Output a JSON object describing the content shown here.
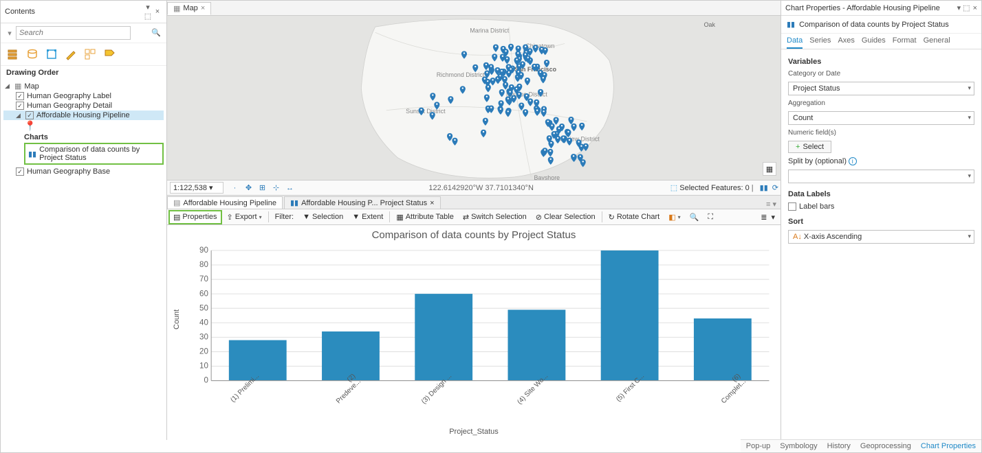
{
  "contents": {
    "title": "Contents",
    "search_placeholder": "Search",
    "drawing_order": "Drawing Order",
    "map_label": "Map",
    "layers": {
      "hgl": "Human Geography Label",
      "hgd": "Human Geography Detail",
      "ahp": "Affordable Housing Pipeline",
      "hgb": "Human Geography Base"
    },
    "charts_head": "Charts",
    "chart_item": "Comparison of data counts by Project Status"
  },
  "map": {
    "tab": "Map",
    "scale": "1:122,538",
    "coords": "122.6142920°W 37.7101340°N",
    "selected": "Selected Features: 0",
    "places": {
      "marina": "Marina District",
      "chinatown": "Chinatown",
      "richmond": "Richmond District",
      "sf": "San Francisco",
      "sunset": "Sunset District",
      "mission": "Mission District",
      "bayview": "Bayview District",
      "bayshore": "Bayshore",
      "oak": "Oak"
    }
  },
  "bottom": {
    "tab1": "Affordable Housing Pipeline",
    "tab2": "Affordable Housing P... Project Status",
    "toolbar": {
      "properties": "Properties",
      "export": "Export",
      "filter": "Filter:",
      "selection": "Selection",
      "extent": "Extent",
      "attr_table": "Attribute Table",
      "switch_sel": "Switch Selection",
      "clear_sel": "Clear Selection",
      "rotate": "Rotate Chart"
    }
  },
  "chart_data": {
    "type": "bar",
    "title": "Comparison of data counts by Project Status",
    "xlabel": "Project_Status",
    "ylabel": "Count",
    "ylim": [
      0,
      90
    ],
    "yticks": [
      0,
      10,
      20,
      30,
      40,
      50,
      60,
      70,
      80,
      90
    ],
    "categories": [
      "(1) Prelimi...",
      "(2) Predeve...",
      "(3) Design ...",
      "(4) Site Wo...",
      "(5) First C...",
      "(6) Complet..."
    ],
    "values": [
      28,
      34,
      60,
      49,
      90,
      43
    ]
  },
  "right": {
    "header": "Chart Properties - Affordable Housing Pipeline",
    "subtitle": "Comparison of data counts by Project Status",
    "tabs": [
      "Data",
      "Series",
      "Axes",
      "Guides",
      "Format",
      "General"
    ],
    "variables": "Variables",
    "cat_or_date": "Category or Date",
    "cat_value": "Project Status",
    "aggregation": "Aggregation",
    "agg_value": "Count",
    "numeric_field": "Numeric field(s)",
    "select_btn": "Select",
    "split_by": "Split by (optional)",
    "data_labels": "Data Labels",
    "label_bars": "Label bars",
    "sort": "Sort",
    "sort_value": "X-axis Ascending"
  },
  "status": {
    "popup": "Pop-up",
    "symbology": "Symbology",
    "history": "History",
    "geo": "Geoprocessing",
    "chart_props": "Chart Properties"
  }
}
